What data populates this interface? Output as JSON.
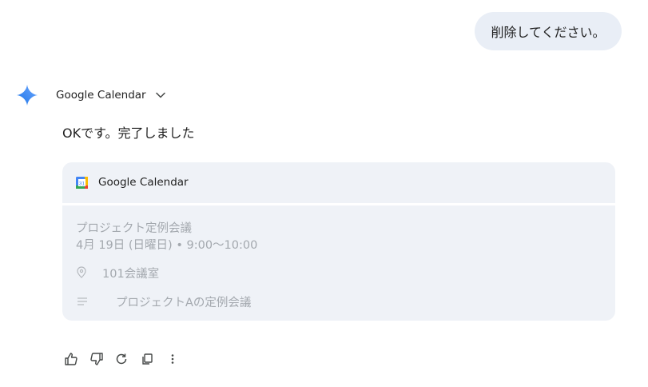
{
  "user_message": {
    "text": "削除してください。"
  },
  "response": {
    "source": {
      "label": "Google Calendar",
      "icon": "chevron-down-icon"
    },
    "text": "OKです。完了しました"
  },
  "calendar_card": {
    "header_label": "Google Calendar",
    "event": {
      "title": "プロジェクト定例会議",
      "datetime": "4月 19日 (日曜日) • 9:00～10:00",
      "location": "101会議室",
      "notes": "プロジェクトAの定例会議"
    }
  },
  "actions": [
    "thumbs-up-icon",
    "thumbs-down-icon",
    "regenerate-icon",
    "copy-icon",
    "more-vert-icon"
  ],
  "colors": {
    "user_bubble": "#e9eef6",
    "card_background": "#eff2f7",
    "muted_text": "#a3a8ae",
    "gemini_blue": "#4285f4"
  }
}
